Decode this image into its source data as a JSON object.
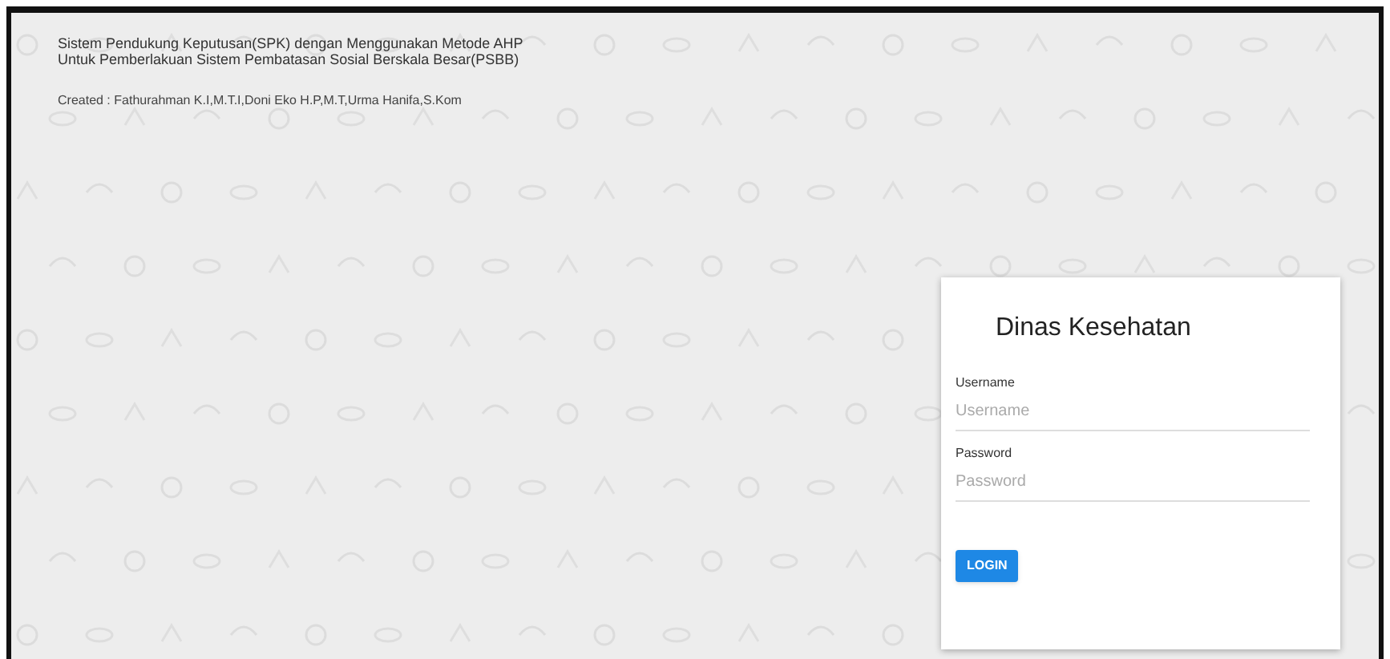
{
  "header": {
    "title_lines": [
      "Sistem Pendukung Keputusan(SPK) dengan Menggunakan Metode AHP",
      "Untuk Pemberlakuan Sistem Pembatasan Sosial Berskala Besar(PSBB)"
    ],
    "credits": "Created : Fathurahman K.I,M.T.I,Doni Eko H.P,M.T,Urma Hanifa,S.Kom"
  },
  "login": {
    "title": "Dinas Kesehatan",
    "fields": [
      {
        "label": "Username",
        "placeholder": "Username"
      },
      {
        "label": "Password",
        "placeholder": "Password"
      }
    ],
    "button": "LOGIN"
  }
}
